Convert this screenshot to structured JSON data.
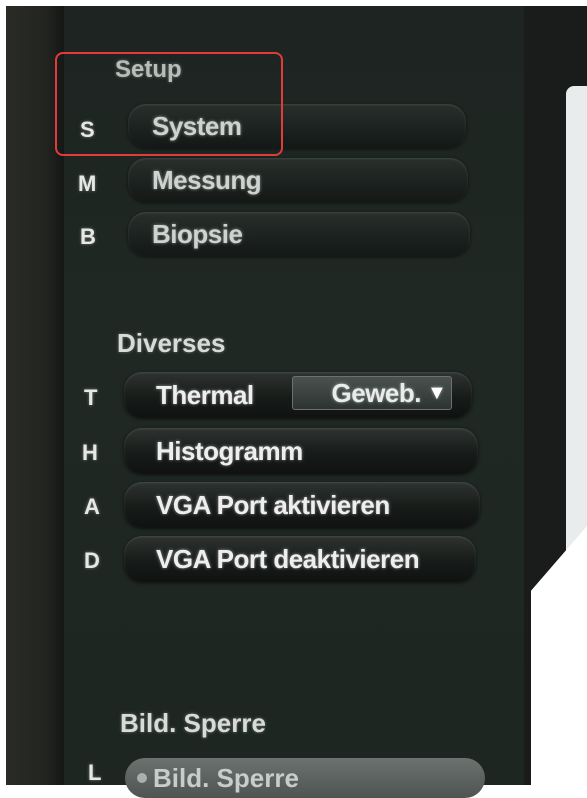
{
  "setup": {
    "title": "Setup",
    "items": [
      {
        "key": "S",
        "label": "System"
      },
      {
        "key": "M",
        "label": "Messung"
      },
      {
        "key": "B",
        "label": "Biopsie"
      }
    ]
  },
  "diverses": {
    "title": "Diverses",
    "thermal": {
      "key": "T",
      "label": "Thermal",
      "selected": "Geweb."
    },
    "items": [
      {
        "key": "H",
        "label": "Histogramm"
      },
      {
        "key": "A",
        "label": "VGA Port aktivieren"
      },
      {
        "key": "D",
        "label": "VGA Port deaktivieren"
      }
    ]
  },
  "bild_sperre": {
    "title": "Bild. Sperre",
    "key": "L",
    "button_label": "Bild. Sperre"
  },
  "colors": {
    "highlight": "#e23b3b",
    "panel_bg": "#1e2622"
  },
  "icons": {
    "dropdown": "triangle-down-icon"
  }
}
